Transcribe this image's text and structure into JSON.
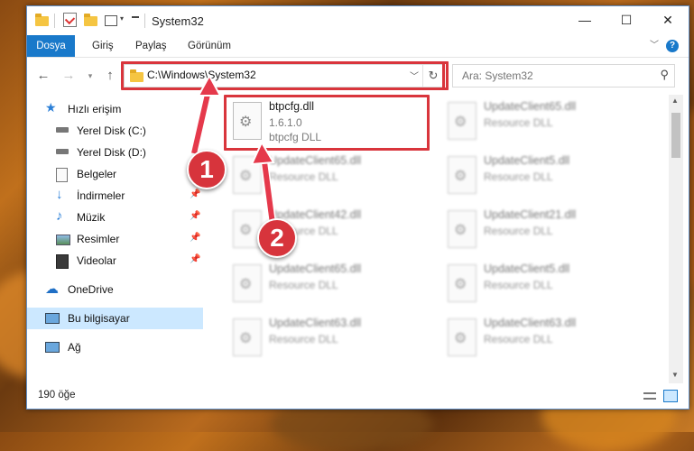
{
  "window": {
    "title": "System32",
    "controls": {
      "minimize": "—",
      "maximize": "☐",
      "close": "✕"
    }
  },
  "ribbon": {
    "tabs": [
      "Dosya",
      "Giriş",
      "Paylaş",
      "Görünüm"
    ],
    "collapse_icon": "chevron-down-icon",
    "help_icon": "help-icon"
  },
  "navigation": {
    "address": "C:\\Windows\\System32",
    "search_placeholder": "Ara: System32"
  },
  "sidebar": {
    "items": [
      {
        "label": "Hızlı erişim",
        "icon": "star-icon"
      },
      {
        "label": "Yerel Disk (C:)",
        "icon": "drive-icon"
      },
      {
        "label": "Yerel Disk (D:)",
        "icon": "drive-icon"
      },
      {
        "label": "Belgeler",
        "icon": "documents-icon"
      },
      {
        "label": "İndirmeler",
        "icon": "download-icon"
      },
      {
        "label": "Müzik",
        "icon": "music-icon"
      },
      {
        "label": "Resimler",
        "icon": "pictures-icon"
      },
      {
        "label": "Videolar",
        "icon": "video-icon"
      },
      {
        "label": "OneDrive",
        "icon": "cloud-icon"
      },
      {
        "label": "Bu bilgisayar",
        "icon": "computer-icon"
      },
      {
        "label": "Ağ",
        "icon": "network-icon"
      }
    ]
  },
  "files": [
    {
      "name": "btpcfg.dll",
      "version": "1.6.1.0",
      "description": "btpcfg DLL"
    },
    {
      "name": "UpdateClient65.dll",
      "description": "Resource DLL"
    },
    {
      "name": "UpdateClient65.dll",
      "description": "Resource DLL"
    },
    {
      "name": "UpdateClient5.dll",
      "description": "Resource DLL"
    },
    {
      "name": "UpdateClient42.dll",
      "description": "Resource DLL"
    },
    {
      "name": "UpdateClient21.dll",
      "description": "Resource DLL"
    },
    {
      "name": "UpdateClient65.dll",
      "description": "Resource DLL"
    },
    {
      "name": "UpdateClient5.dll",
      "description": "Resource DLL"
    },
    {
      "name": "UpdateClient63.dll",
      "description": "Resource DLL"
    },
    {
      "name": "UpdateClient63.dll",
      "description": "Resource DLL"
    }
  ],
  "status": {
    "item_count": "190 öğe"
  },
  "annotations": {
    "step1": "1",
    "step2": "2",
    "highlight_color": "#d9353c"
  }
}
